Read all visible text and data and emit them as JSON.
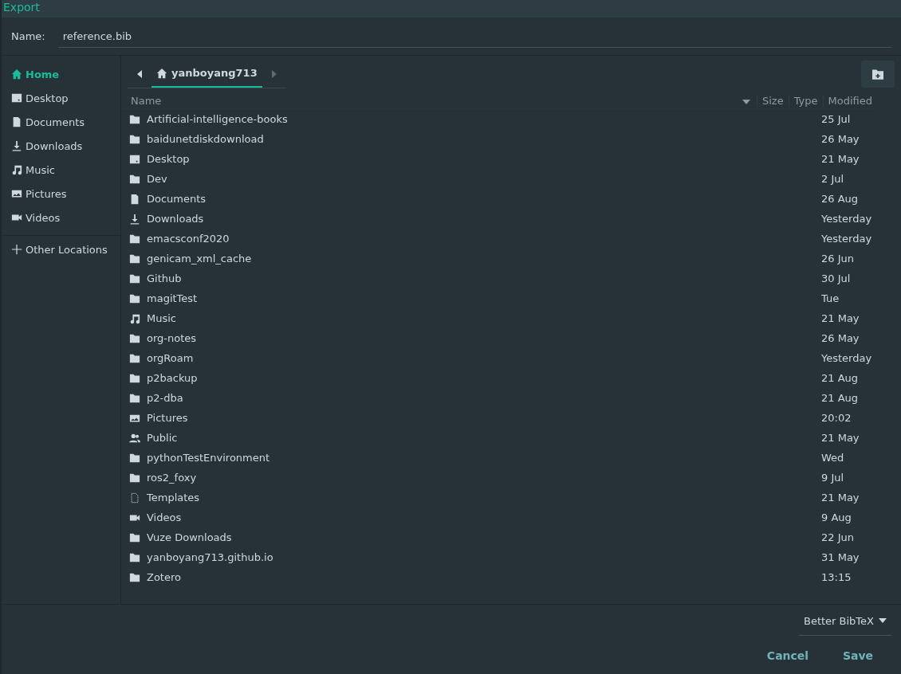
{
  "window": {
    "title": "Export"
  },
  "name_field": {
    "label": "Name:",
    "value": "reference.bib"
  },
  "sidebar": {
    "items": [
      {
        "label": "Home",
        "kind": "home",
        "selected": true
      },
      {
        "label": "Desktop",
        "kind": "desktop",
        "selected": false
      },
      {
        "label": "Documents",
        "kind": "document",
        "selected": false
      },
      {
        "label": "Downloads",
        "kind": "download",
        "selected": false
      },
      {
        "label": "Music",
        "kind": "music",
        "selected": false
      },
      {
        "label": "Pictures",
        "kind": "pictures",
        "selected": false
      },
      {
        "label": "Videos",
        "kind": "videos",
        "selected": false
      }
    ],
    "other": {
      "label": "Other Locations",
      "kind": "plus"
    }
  },
  "path_bar": {
    "crumbs": [
      {
        "label": "yanboyang713",
        "kind": "home",
        "selected": true
      }
    ]
  },
  "table": {
    "columns": [
      "Name",
      "Size",
      "Type",
      "Modified"
    ],
    "rows": [
      {
        "name": "Artificial-intelligence-books",
        "kind": "folder",
        "modified": "25 Jul"
      },
      {
        "name": "baidunetdiskdownload",
        "kind": "folder",
        "modified": "26 May"
      },
      {
        "name": "Desktop",
        "kind": "desktop",
        "modified": "21 May"
      },
      {
        "name": "Dev",
        "kind": "folder",
        "modified": "2 Jul"
      },
      {
        "name": "Documents",
        "kind": "document",
        "modified": "26 Aug"
      },
      {
        "name": "Downloads",
        "kind": "download",
        "modified": "Yesterday"
      },
      {
        "name": "emacsconf2020",
        "kind": "folder",
        "modified": "Yesterday"
      },
      {
        "name": "genicam_xml_cache",
        "kind": "folder",
        "modified": "26 Jun"
      },
      {
        "name": "Github",
        "kind": "folder",
        "modified": "30 Jul"
      },
      {
        "name": "magitTest",
        "kind": "folder",
        "modified": "Tue"
      },
      {
        "name": "Music",
        "kind": "music",
        "modified": "21 May"
      },
      {
        "name": "org-notes",
        "kind": "folder",
        "modified": "26 May"
      },
      {
        "name": "orgRoam",
        "kind": "folder",
        "modified": "Yesterday"
      },
      {
        "name": "p2backup",
        "kind": "folder",
        "modified": "21 Aug"
      },
      {
        "name": "p2-dba",
        "kind": "folder",
        "modified": "21 Aug"
      },
      {
        "name": "Pictures",
        "kind": "pictures",
        "modified": "20:02"
      },
      {
        "name": "Public",
        "kind": "public",
        "modified": "21 May"
      },
      {
        "name": "pythonTestEnvironment",
        "kind": "folder",
        "modified": "Wed"
      },
      {
        "name": "ros2_foxy",
        "kind": "folder",
        "modified": "9 Jul"
      },
      {
        "name": "Templates",
        "kind": "templates",
        "modified": "21 May"
      },
      {
        "name": "Videos",
        "kind": "videos",
        "modified": "9 Aug"
      },
      {
        "name": "Vuze Downloads",
        "kind": "folder",
        "modified": "22 Jun"
      },
      {
        "name": "yanboyang713.github.io",
        "kind": "folder",
        "modified": "31 May"
      },
      {
        "name": "Zotero",
        "kind": "folder",
        "modified": "13:15"
      }
    ]
  },
  "filter": {
    "value": "Better BibTeX"
  },
  "buttons": [
    {
      "label": "Cancel"
    },
    {
      "label": "Save"
    }
  ]
}
